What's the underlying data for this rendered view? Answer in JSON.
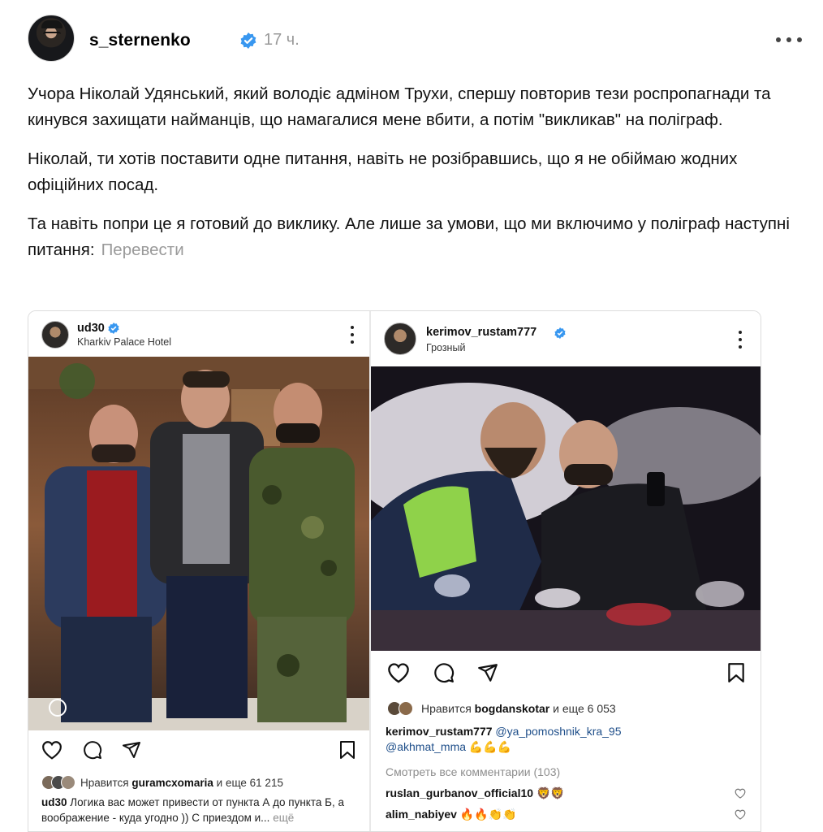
{
  "post": {
    "username": "s_sternenko",
    "time": "17 ч.",
    "paragraphs": [
      "Учора Ніколай Удянський, який володіє адміном Трухи, спершу повторив тези роспропагнади та кинувся захищати найманців, що намагалися мене вбити, а потім \"викликав\" на поліграф.",
      "Ніколай, ти хотів поставити одне питання, навіть не розібравшись, що я не обіймаю жодних офіційних посад.",
      "Та навіть попри це я готовий до виклику. Але лише за умови, що ми включимо у поліграф наступні питання:"
    ],
    "translate_label": "Перевести"
  },
  "left_post": {
    "username": "ud30",
    "location": "Kharkiv Palace Hotel",
    "likes_prefix": "Нравится",
    "likes_user": "guramcxomaria",
    "likes_suffix": "и еще 61 215",
    "caption_user": "ud30",
    "caption_text": "Логика вас может привести от пункта А до пункта Б, а воображение - куда угодно )) С приездом и...",
    "caption_more": "ещё"
  },
  "right_post": {
    "username": "kerimov_rustam777",
    "location": "Грозный",
    "likes_prefix": "Нравится",
    "likes_user": "bogdanskotar",
    "likes_suffix": "и еще 6 053",
    "caption_user": "kerimov_rustam777",
    "caption_mention1": "@ya_pomoshnik_kra_95",
    "caption_mention2": "@akhmat_mma",
    "caption_emoji": "💪💪💪",
    "view_comments": "Смотреть все комментарии (103)",
    "comments": [
      {
        "user": "ruslan_gurbanov_official10",
        "text": "🦁🦁"
      },
      {
        "user": "alim_nabiyev",
        "text": "🔥🔥👏👏"
      }
    ]
  },
  "colors": {
    "verified_blue": "#3897f0",
    "muted_gray": "#9a9a9a"
  },
  "icons": [
    "verified-icon",
    "more-icon",
    "heart-icon",
    "comment-icon",
    "share-icon",
    "bookmark-icon",
    "profile-badge-icon"
  ]
}
